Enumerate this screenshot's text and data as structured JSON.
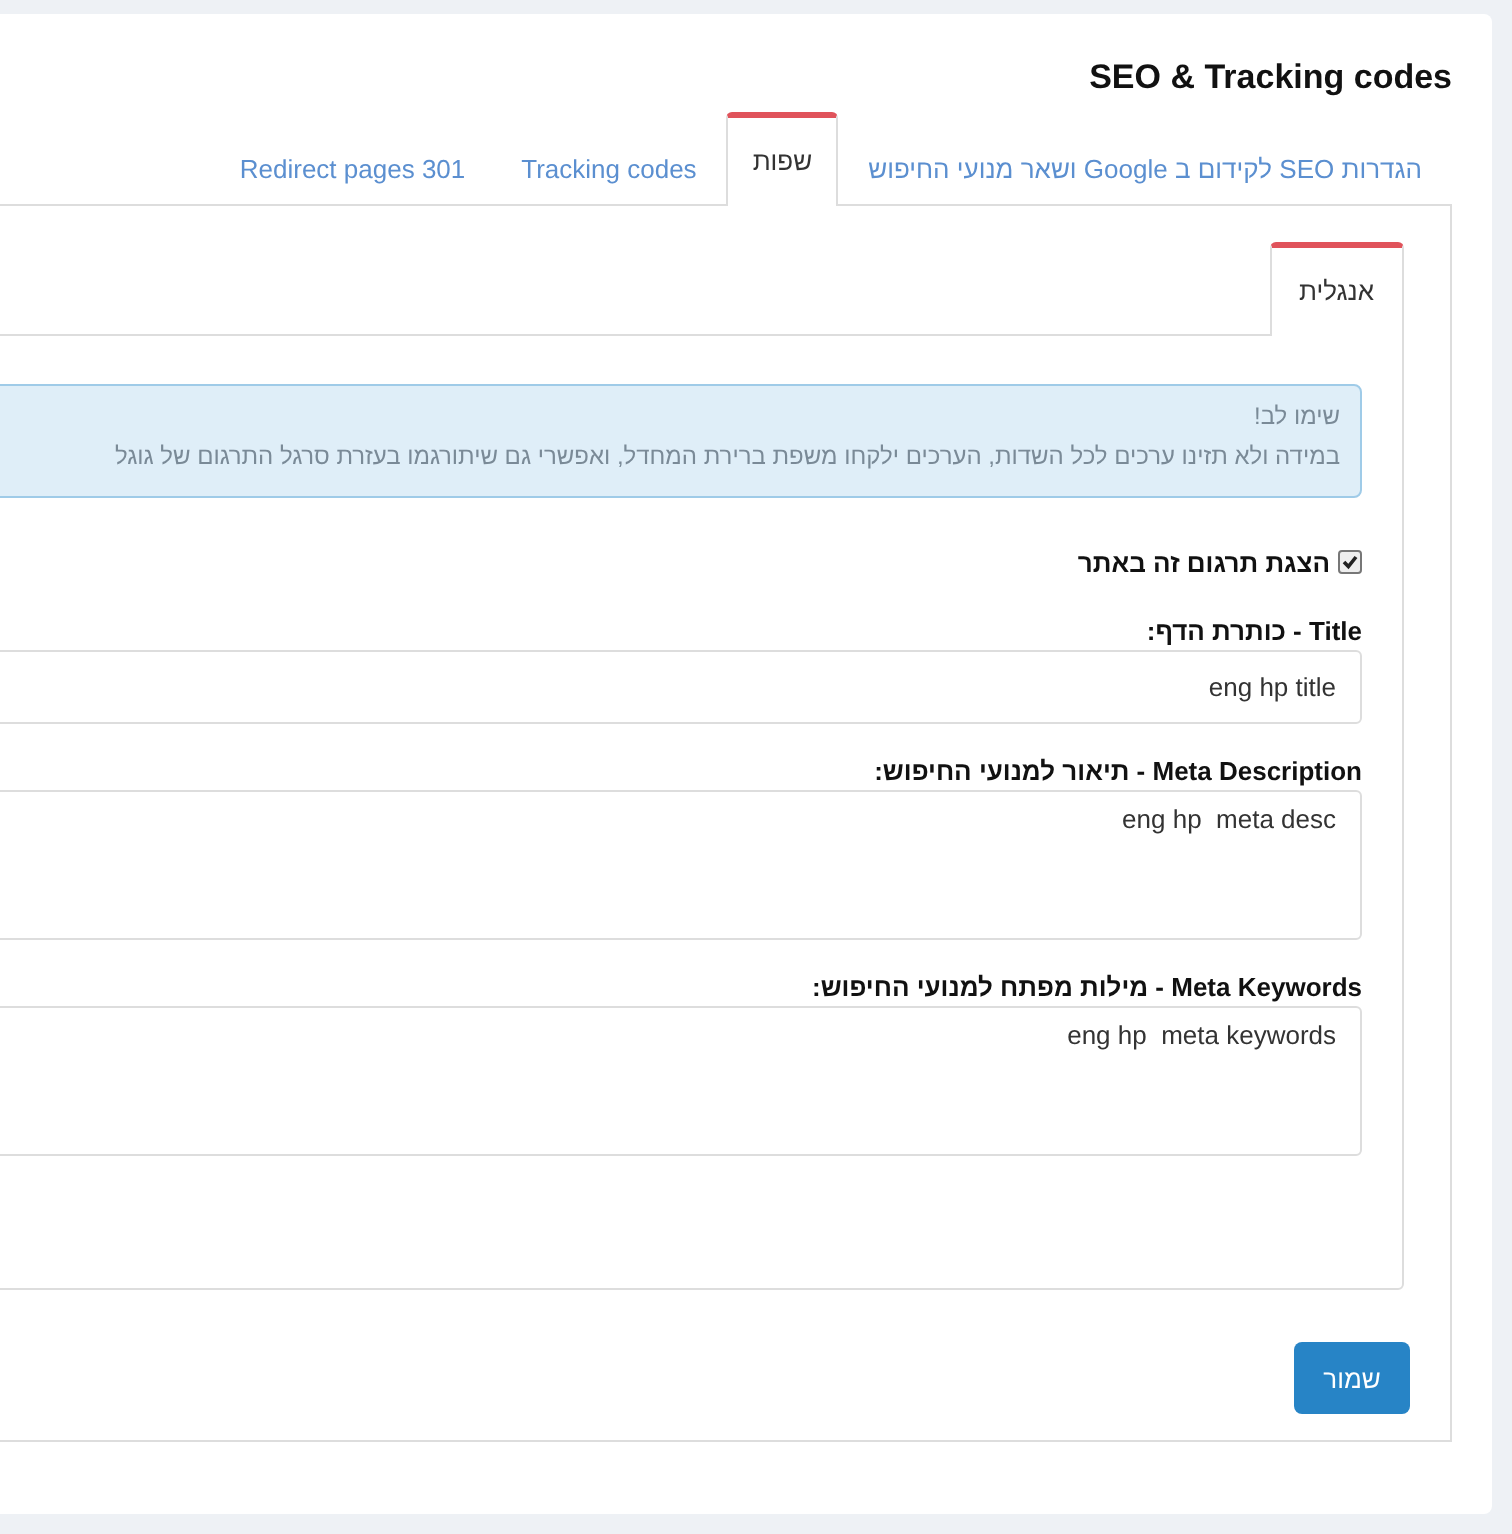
{
  "title": "SEO & Tracking codes",
  "tabs": [
    {
      "label": "הגדרות SEO לקידום ב Google ושאר מנועי החיפוש",
      "selected": false
    },
    {
      "label": "שפות",
      "selected": true
    },
    {
      "label": "Tracking codes",
      "selected": false
    },
    {
      "label": "Redirect pages 301",
      "selected": false
    }
  ],
  "language_tabs": [
    {
      "label": "אנגלית",
      "selected": true
    }
  ],
  "alert": {
    "heading": "שימו לב!",
    "text": "במידה ולא תזינו ערכים לכל השדות, הערכים ילקחו משפת ברירת המחדל, ואפשרי גם שיתורגמו בעזרת סרגל התרגום של גוגל"
  },
  "show_translation": {
    "label": "הצגת תרגום זה באתר",
    "checked": true
  },
  "fields": [
    {
      "kind": "input",
      "label": "Title - כותרת הדף:",
      "value": "eng hp title"
    },
    {
      "kind": "textarea",
      "label": "Meta Description - תיאור למנועי החיפוש:",
      "value": "eng hp  meta desc"
    },
    {
      "kind": "textarea",
      "label": "Meta Keywords - מילות מפתח למנועי החיפוש:",
      "value": "eng hp  meta keywords"
    }
  ],
  "save_button": "שמור"
}
